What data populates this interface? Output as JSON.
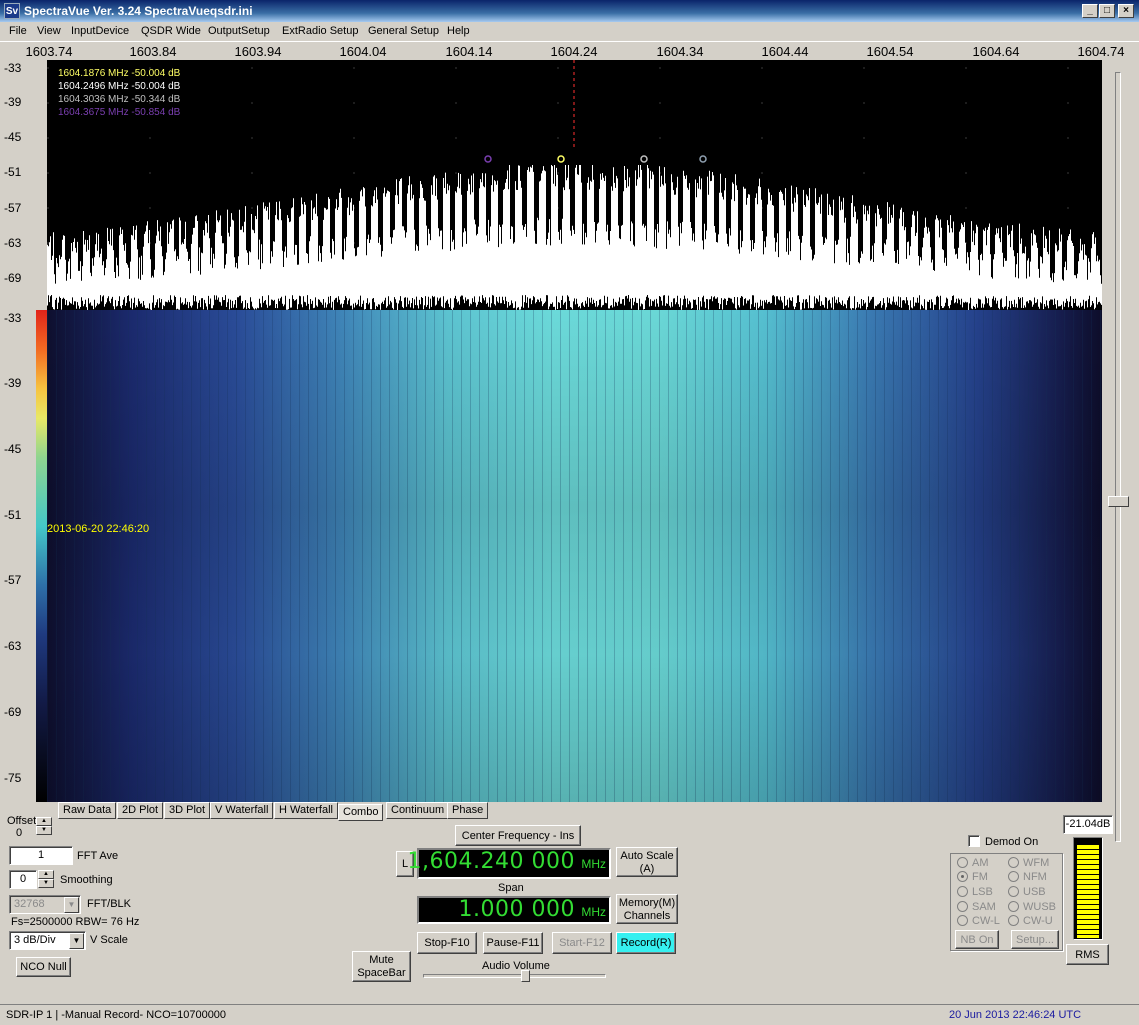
{
  "window": {
    "title": "SpectraVue Ver. 3.24  SpectraVueqsdr.ini",
    "icon_text": "Sv",
    "minimize": "_",
    "maximize": "□",
    "close": "×"
  },
  "menu": [
    "File",
    "View",
    "InputDevice",
    "QSDR Wide",
    "OutputSetup",
    "ExtRadio Setup",
    "General Setup",
    "Help"
  ],
  "freq_axis": {
    "labels": [
      "1603.74",
      "1603.84",
      "1603.94",
      "1604.04",
      "1604.14",
      "1604.24",
      "1604.34",
      "1604.44",
      "1604.54",
      "1604.64",
      "1604.74"
    ]
  },
  "spectrum": {
    "db_labels": [
      "-33",
      "-39",
      "-45",
      "-51",
      "-57",
      "-63",
      "-69"
    ],
    "markers": [
      {
        "text": "1604.1876 MHz  -50.004 dB",
        "color": "#ffff66"
      },
      {
        "text": "1604.2496 MHz  -50.004 dB",
        "color": "#ffffff"
      },
      {
        "text": "1604.3036 MHz  -50.344 dB",
        "color": "#c0c0c0"
      },
      {
        "text": "1604.3675 MHz  -50.854 dB",
        "color": "#7a3fb0"
      }
    ]
  },
  "waterfall": {
    "db_labels": [
      "-33",
      "-39",
      "-45",
      "-51",
      "-57",
      "-63",
      "-69",
      "-75"
    ],
    "timestamp": "2013-06-20 22:46:20"
  },
  "tabs": [
    "Raw Data",
    "2D Plot",
    "3D Plot",
    "V Waterfall",
    "H Waterfall",
    "Combo",
    "Continuum",
    "Phase"
  ],
  "active_tab": "Combo",
  "left_controls": {
    "offset_label": "Offset",
    "offset_value": "0",
    "fft_ave_value": "1",
    "fft_ave_label": "FFT Ave",
    "smoothing_value": "0",
    "smoothing_label": "Smoothing",
    "fft_blk_value": "32768",
    "fft_blk_label": "FFT/BLK",
    "fs_info": "Fs=2500000 RBW=  76 Hz",
    "vscale_value": "3 dB/Div",
    "vscale_label": "V Scale",
    "nco_null": "NCO Null"
  },
  "center_controls": {
    "center_freq_button": "Center Frequency - Ins",
    "l_button": "L",
    "center_freq_value": "1,604.240 000",
    "center_freq_unit": "MHz",
    "auto_scale": "Auto Scale\n(A)",
    "span_label": "Span",
    "span_value": "1.000 000",
    "span_unit": "MHz",
    "memory": "Memory(M)\nChannels",
    "stop": "Stop-F10",
    "pause": "Pause-F11",
    "start": "Start-F12",
    "record": "Record(R)",
    "mute": "Mute\nSpaceBar",
    "audio_volume_label": "Audio Volume",
    "audio_volume_level": 0.55
  },
  "right_controls": {
    "demod_on": "Demod On",
    "demod_on_checked": false,
    "modes_left": [
      "AM",
      "FM",
      "LSB",
      "SAM",
      "CW-L"
    ],
    "modes_right": [
      "WFM",
      "NFM",
      "USB",
      "WUSB",
      "CW-U"
    ],
    "selected_mode": "FM",
    "nb_on": "NB On",
    "setup": "Setup...",
    "level_value": "-21.04dB",
    "level_fraction": 0.97,
    "rms": "RMS"
  },
  "statusbar": {
    "device": "SDR-IP 1",
    "mode": "-Manual Record-",
    "nco": "NCO=10700000",
    "datetime": "20 Jun 2013  22:46:24 UTC"
  },
  "colors": {
    "lcd_text": "#33dd33",
    "record_button": "#36f0f0",
    "timestamp": "#ffff00",
    "status_datetime": "#1a1aa0"
  }
}
